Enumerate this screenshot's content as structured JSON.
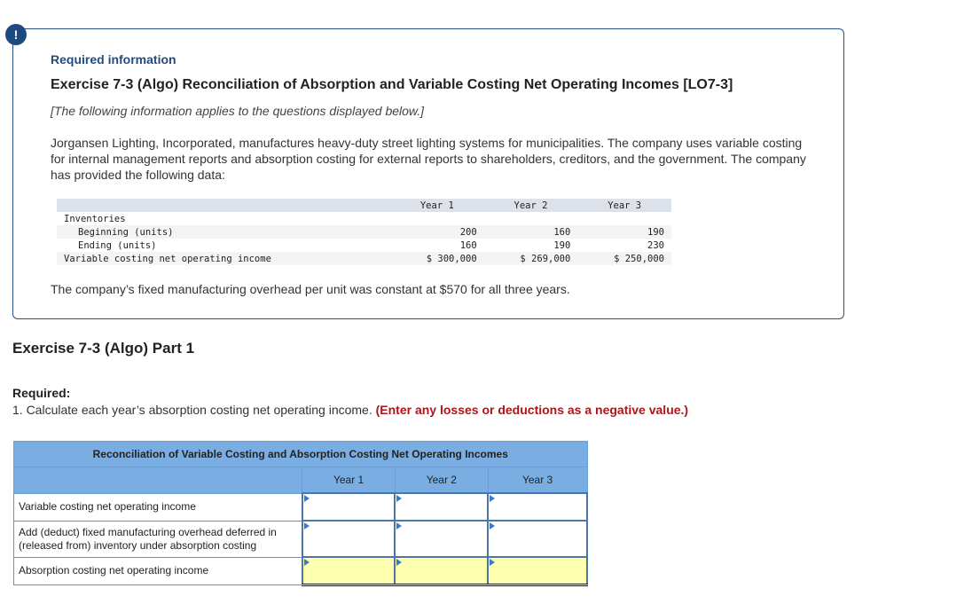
{
  "badge": {
    "icon": "exclamation-icon",
    "glyph": "!"
  },
  "info": {
    "required_information": "Required information",
    "exercise_title": "Exercise 7-3 (Algo) Reconciliation of Absorption and Variable Costing Net Operating Incomes [LO7-3]",
    "note": "[The following information applies to the questions displayed below.]",
    "paragraph": "Jorgansen Lighting, Incorporated, manufactures heavy-duty street lighting systems for municipalities. The company uses variable costing for internal management reports and absorption costing for external reports to shareholders, creditors, and the government. The company has provided the following data:",
    "fixed_overhead_note": "The company’s fixed manufacturing overhead per unit was constant at $570 for all three years."
  },
  "data_table": {
    "headers": [
      "",
      "Year 1",
      "Year 2",
      "Year 3"
    ],
    "rows": [
      {
        "label": "Inventories",
        "values": [
          "",
          "",
          ""
        ]
      },
      {
        "label": "Beginning (units)",
        "values": [
          "200",
          "160",
          "190"
        ]
      },
      {
        "label": "Ending (units)",
        "values": [
          "160",
          "190",
          "230"
        ]
      },
      {
        "label": "Variable costing net operating income",
        "values": [
          "$ 300,000",
          "$ 269,000",
          "$ 250,000"
        ]
      }
    ]
  },
  "part": {
    "title": "Exercise 7-3 (Algo) Part 1",
    "required_label": "Required:",
    "required_text": "1. Calculate each year’s absorption costing net operating income.",
    "warning": "(Enter any losses or deductions as a negative value.)"
  },
  "recon_table": {
    "title": "Reconciliation of Variable Costing and Absorption Costing Net Operating Incomes",
    "columns": [
      "Year 1",
      "Year 2",
      "Year 3"
    ],
    "rows": [
      {
        "label": "Variable costing net operating income",
        "values": [
          "",
          "",
          ""
        ]
      },
      {
        "label": "Add (deduct) fixed manufacturing overhead deferred in (released from) inventory under absorption costing",
        "values": [
          "",
          "",
          ""
        ]
      },
      {
        "label": "Absorption costing net operating income",
        "values": [
          "",
          "",
          ""
        ]
      }
    ]
  },
  "colors": {
    "accent_navy": "#1d4a7e",
    "table_header_blue": "#7aaee3",
    "total_row_yellow": "#ffffb0",
    "warning_red": "#b0141a"
  }
}
